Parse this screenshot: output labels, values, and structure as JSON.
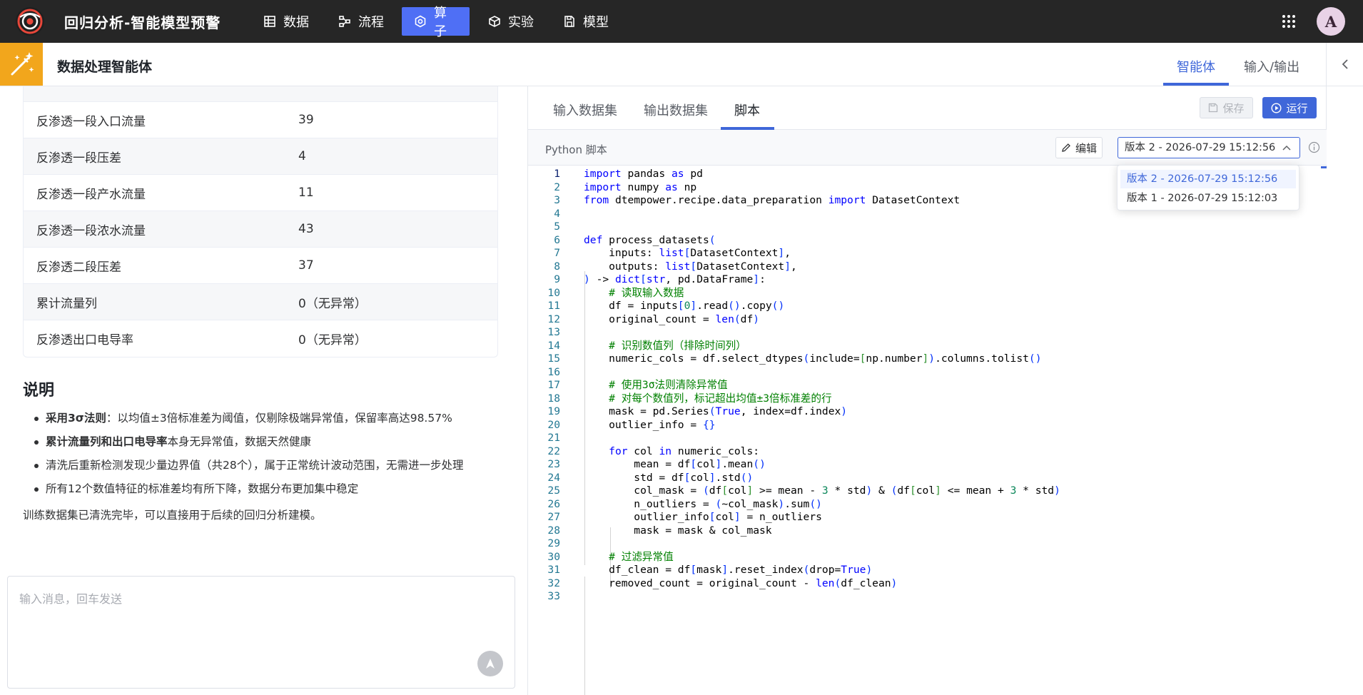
{
  "app": {
    "title": "回归分析-智能模型预警",
    "avatar": "A"
  },
  "nav": [
    {
      "label": "数据",
      "icon": "table-icon"
    },
    {
      "label": "流程",
      "icon": "flow-icon"
    },
    {
      "label": "算子",
      "icon": "operator-icon",
      "active": true
    },
    {
      "label": "实验",
      "icon": "cube-icon"
    },
    {
      "label": "模型",
      "icon": "model-icon"
    }
  ],
  "agent": {
    "title": "数据处理智能体",
    "tab_agent": "智能体",
    "tab_io": "输入/输出"
  },
  "table_rows": [
    {
      "name": "反渗透一段入口流量",
      "value": "39"
    },
    {
      "name": "反渗透一段压差",
      "value": "4"
    },
    {
      "name": "反渗透一段产水流量",
      "value": "11"
    },
    {
      "name": "反渗透一段浓水流量",
      "value": "43"
    },
    {
      "name": "反渗透二段压差",
      "value": "37"
    },
    {
      "name": "累计流量列",
      "value": "0（无异常）"
    },
    {
      "name": "反渗透出口电导率",
      "value": "0（无异常）"
    }
  ],
  "notes": {
    "title": "说明",
    "b1_bold": "采用3σ法则",
    "b1_rest": "：以均值±3倍标准差为阈值，仅剔除极端异常值，保留率高达98.57%",
    "b2_bold": "累计流量列和出口电导率",
    "b2_rest": "本身无异常值，数据天然健康",
    "b3": "清洗后重新检测发现少量边界值（共28个），属于正常统计波动范围，无需进一步处理",
    "b4": "所有12个数值特征的标准差均有所下降，数据分布更加集中稳定",
    "conclusion": "训练数据集已清洗完毕，可以直接用于后续的回归分析建模。"
  },
  "chat": {
    "placeholder": "输入消息，回车发送"
  },
  "right_tabs": {
    "input": "输入数据集",
    "output": "输出数据集",
    "script": "脚本"
  },
  "buttons": {
    "save": "保存",
    "run": "运行",
    "edit": "编辑"
  },
  "script_label": "Python 脚本",
  "version": {
    "selected": "版本 2 - 2026-07-29 15:12:56",
    "options": [
      "版本 2 - 2026-07-29 15:12:56",
      "版本 1 - 2026-07-29 15:12:03"
    ]
  },
  "code_lines": [
    "import pandas as pd",
    "import numpy as np",
    "from dtempower.recipe.data_preparation import DatasetContext",
    "",
    "",
    "def process_datasets(",
    "    inputs: list[DatasetContext],",
    "    outputs: list[DatasetContext],",
    ") -> dict[str, pd.DataFrame]:",
    "    # 读取输入数据",
    "    df = inputs[0].read().copy()",
    "    original_count = len(df)",
    "",
    "    # 识别数值列（排除时间列）",
    "    numeric_cols = df.select_dtypes(include=[np.number]).columns.tolist()",
    "",
    "    # 使用3σ法则清除异常值",
    "    # 对每个数值列，标记超出均值±3倍标准差的行",
    "    mask = pd.Series(True, index=df.index)",
    "    outlier_info = {}",
    "",
    "    for col in numeric_cols:",
    "        mean = df[col].mean()",
    "        std = df[col].std()",
    "        col_mask = (df[col] >= mean - 3 * std) & (df[col] <= mean + 3 * std)",
    "        n_outliers = (~col_mask).sum()",
    "        outlier_info[col] = n_outliers",
    "        mask = mask & col_mask",
    "",
    "    # 过滤异常值",
    "    df_clean = df[mask].reset_index(drop=True)",
    "    removed_count = original_count - len(df_clean)",
    ""
  ]
}
